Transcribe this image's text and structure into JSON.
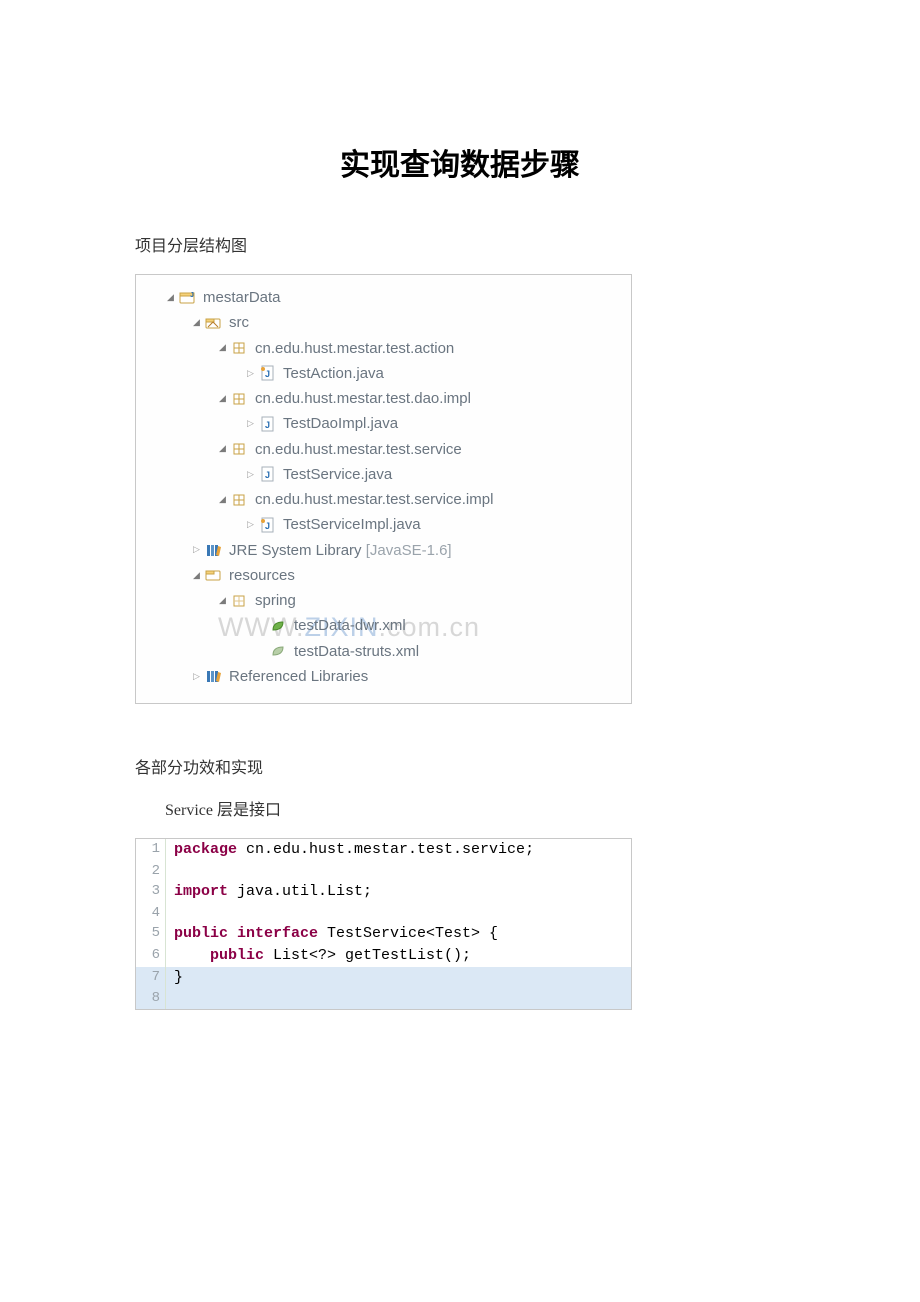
{
  "title": "实现查询数据步骤",
  "section1": "项目分层结构图",
  "section2": "各部分功效和实现",
  "section3": "Service 层是接口",
  "watermark_front": "WWW.",
  "watermark_back": ".com.cn",
  "tree": {
    "project": "mestarData",
    "src": "src",
    "pkg_action": "cn.edu.hust.mestar.test.action",
    "file_action": "TestAction.java",
    "pkg_dao": "cn.edu.hust.mestar.test.dao.impl",
    "file_dao": "TestDaoImpl.java",
    "pkg_service": "cn.edu.hust.mestar.test.service",
    "file_service": "TestService.java",
    "pkg_service_impl": "cn.edu.hust.mestar.test.service.impl",
    "file_service_impl": "TestServiceImpl.java",
    "jre": "JRE System Library",
    "jre_ver": " [JavaSE-1.6]",
    "resources": "resources",
    "spring": "spring",
    "xml1": "testData-dwr.xml",
    "xml2": "testData-struts.xml",
    "reflib": "Referenced Libraries"
  },
  "code": {
    "l1a": "package",
    "l1b": " cn.edu.hust.mestar.test.service;",
    "l2": "",
    "l3a": "import",
    "l3b": " java.util.List;",
    "l4": "",
    "l5a": "public interface",
    "l5b": " TestService<Test> {",
    "l6a": "    public",
    "l6b": " List<?> getTestList();",
    "l7": "}",
    "l8": ""
  }
}
